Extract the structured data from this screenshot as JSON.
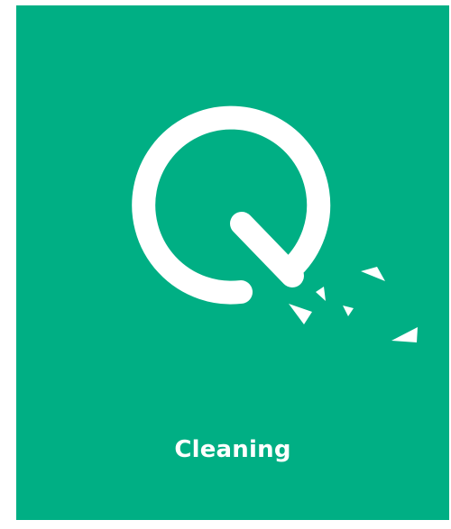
{
  "tile": {
    "label": "Cleaning",
    "icon": "cleaning-q-icon",
    "background_color": "#00AF84",
    "foreground_color": "#FFFFFF"
  }
}
